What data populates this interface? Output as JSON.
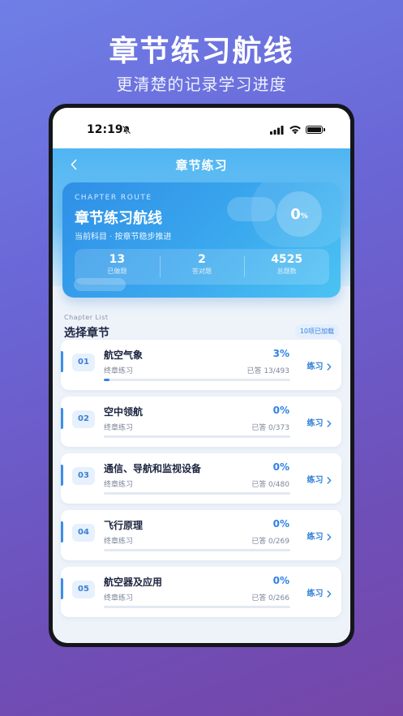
{
  "promo": {
    "title": "章节练习航线",
    "subtitle": "更清楚的记录学习进度"
  },
  "status_bar": {
    "time": "12:19",
    "icons": [
      "bell-mute-icon",
      "signal-icon",
      "wifi-icon",
      "battery-icon"
    ]
  },
  "nav": {
    "title": "章节练习",
    "back_icon": "chevron-left-icon"
  },
  "hero": {
    "label": "CHAPTER ROUTE",
    "title": "章节练习航线",
    "description": "当前科目 · 按章节稳步推进",
    "percent_value": "0",
    "percent_unit": "%",
    "stats": [
      {
        "value": "13",
        "label": "已做题"
      },
      {
        "value": "2",
        "label": "答对题"
      },
      {
        "value": "4525",
        "label": "总题数"
      }
    ]
  },
  "chapter_list": {
    "subtitle": "Chapter List",
    "title": "选择章节",
    "loaded_badge": "10项已加载",
    "items": [
      {
        "num": "01",
        "name": "航空气象",
        "tag": "终章练习",
        "percent": "3%",
        "answered": "已答 13/493",
        "progress": 0.03,
        "action": "练习"
      },
      {
        "num": "02",
        "name": "空中领航",
        "tag": "终章练习",
        "percent": "0%",
        "answered": "已答 0/373",
        "progress": 0,
        "action": "练习"
      },
      {
        "num": "03",
        "name": "通信、导航和监视设备",
        "tag": "终章练习",
        "percent": "0%",
        "answered": "已答 0/480",
        "progress": 0,
        "action": "练习"
      },
      {
        "num": "04",
        "name": "飞行原理",
        "tag": "终章练习",
        "percent": "0%",
        "answered": "已答 0/269",
        "progress": 0,
        "action": "练习"
      },
      {
        "num": "05",
        "name": "航空器及应用",
        "tag": "终章练习",
        "percent": "0%",
        "answered": "已答 0/266",
        "progress": 0,
        "action": "练习"
      }
    ]
  },
  "colors": {
    "accent": "#2e82e6",
    "hero_start": "#2f8fe6",
    "hero_end": "#4cc3f3",
    "background_top": "#6f7fe6",
    "background_bottom": "#7546a8"
  }
}
